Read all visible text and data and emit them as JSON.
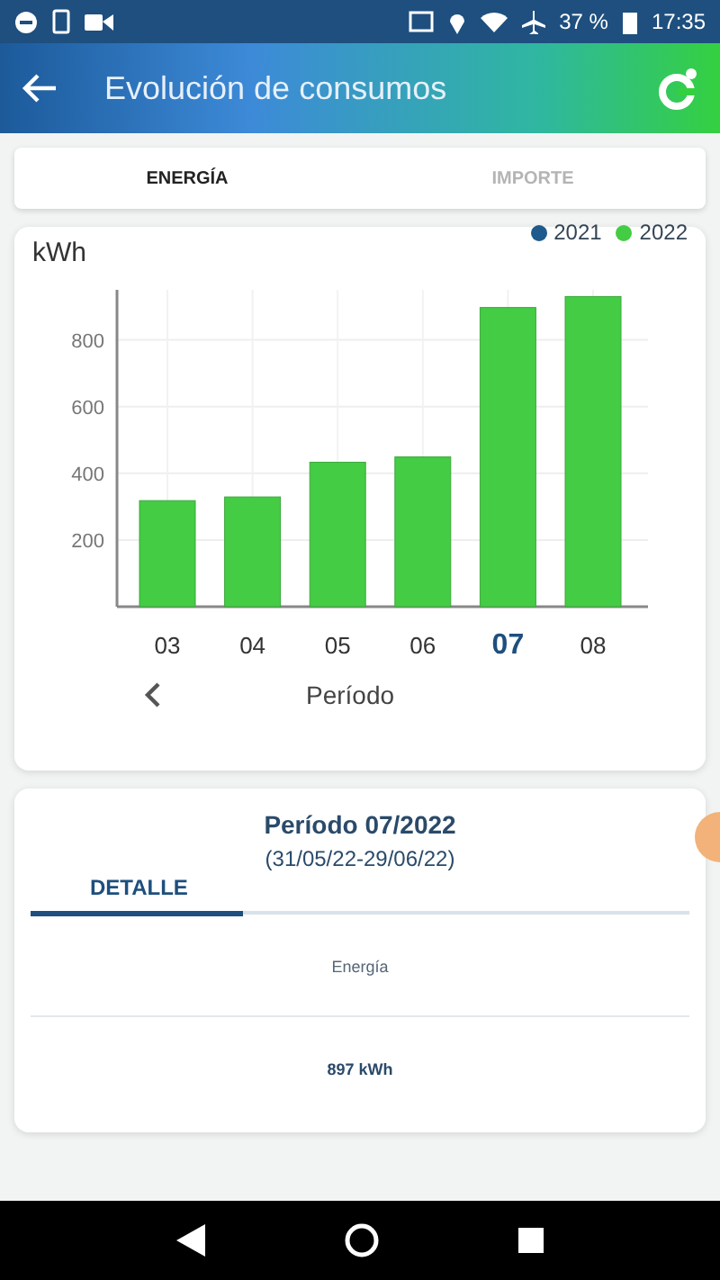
{
  "status_bar": {
    "battery": "37 %",
    "time": "17:35"
  },
  "app_bar": {
    "title": "Evolución de consumos"
  },
  "tabs": [
    {
      "label": "ENERGÍA",
      "selected": true
    },
    {
      "label": "IMPORTE",
      "selected": false
    }
  ],
  "chart": {
    "selected_categories": [
      false,
      false,
      false,
      false,
      true,
      false
    ],
    "period_label": "Período",
    "chart_data": {
      "type": "bar",
      "ylabel": "kWh",
      "categories": [
        "03",
        "04",
        "05",
        "06",
        "07",
        "08"
      ],
      "ylim": [
        0,
        950
      ],
      "yticks": [
        200,
        400,
        600,
        800
      ],
      "grid": true,
      "series": [
        {
          "name": "2021",
          "color": "#1f5a8c",
          "values": [
            null,
            null,
            null,
            null,
            null,
            null
          ]
        },
        {
          "name": "2022",
          "color": "#44cc44",
          "values": [
            318,
            329,
            433,
            449,
            897,
            930
          ]
        }
      ]
    }
  },
  "detail": {
    "title": "Período 07/2022",
    "dates": "(31/05/22-29/06/22)",
    "tab": {
      "label": "DETALLE",
      "selected": true
    },
    "row_label": "Energía",
    "row_value": "897 kWh"
  }
}
